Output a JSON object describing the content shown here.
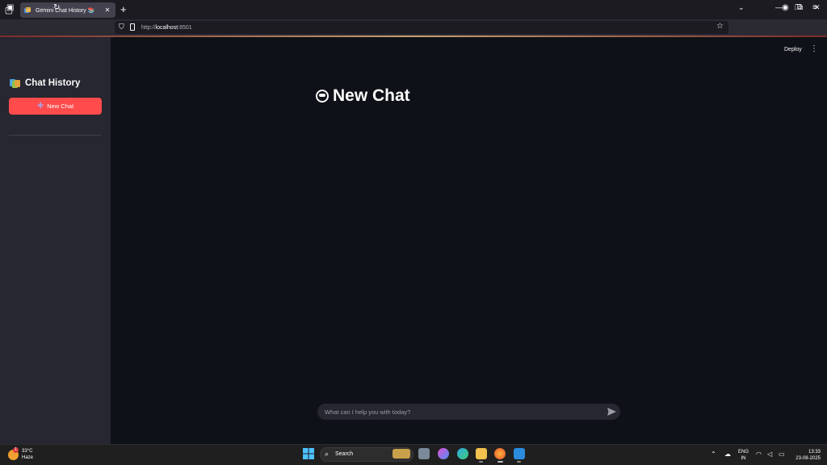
{
  "browser": {
    "tab_title": "Gemini Chat History 📚",
    "new_tab": "+",
    "url_prefix": "http://",
    "url_host": "localhost",
    "url_port": ":8501",
    "win_min": "—",
    "win_max": "❐",
    "win_close": "✕",
    "dropdown": "⌄"
  },
  "sidebar": {
    "title": "Chat History",
    "new_chat_label": "New Chat",
    "new_chat_icon": "plus-icon"
  },
  "toolbar": {
    "deploy_label": "Deploy",
    "menu_icon": "⋮"
  },
  "main": {
    "title": "New Chat",
    "title_icon": "grinning-face-icon"
  },
  "chat_input": {
    "placeholder": "What can I help you with today?"
  },
  "taskbar": {
    "weather_temp": "33°C",
    "weather_desc": "Haze",
    "weather_badge": "1",
    "search_label": "Search",
    "lang_top": "ENG",
    "lang_bottom": "IN",
    "time": "13:33",
    "date": "23-08-2025"
  },
  "colors": {
    "accent": "#ff4b4b",
    "background": "#0e1117",
    "sidebar": "#262730"
  }
}
